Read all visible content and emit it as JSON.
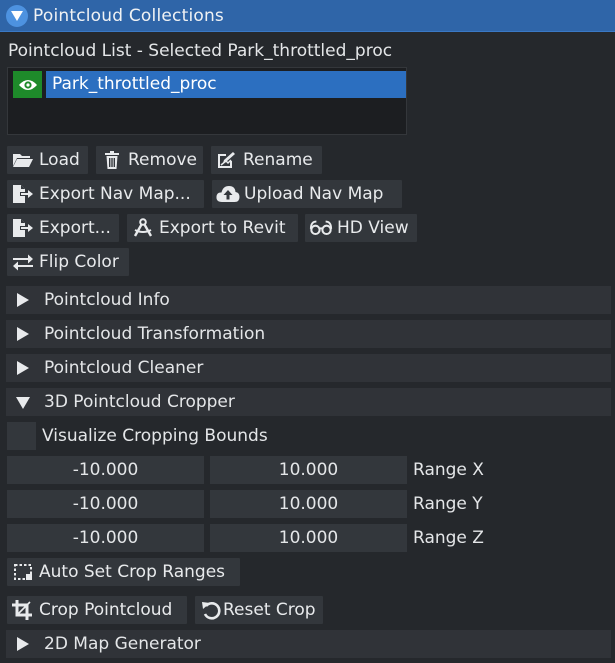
{
  "window": {
    "title": "Pointcloud Collections"
  },
  "list": {
    "label": "Pointcloud List - Selected Park_throttled_proc",
    "items": [
      {
        "name": "Park_throttled_proc",
        "visible": true
      }
    ]
  },
  "buttons": {
    "load": "Load",
    "remove": "Remove",
    "rename": "Rename",
    "export_nav_map": "Export Nav Map...",
    "upload_nav_map": "Upload Nav Map",
    "export": "Export...",
    "export_revit": "Export to Revit",
    "hd_view": "HD View",
    "flip_color": "Flip Color",
    "auto_set_crop": "Auto Set Crop Ranges",
    "crop_pointcloud": "Crop Pointcloud",
    "reset_crop": "Reset Crop"
  },
  "sections": {
    "info": "Pointcloud Info",
    "transformation": "Pointcloud Transformation",
    "cleaner": "Pointcloud Cleaner",
    "cropper": "3D Pointcloud Cropper",
    "map_generator": "2D Map Generator"
  },
  "cropper": {
    "visualize_label": "Visualize Cropping Bounds",
    "visualize_checked": false,
    "ranges": [
      {
        "label": "Range X",
        "min": "-10.000",
        "max": "10.000"
      },
      {
        "label": "Range Y",
        "min": "-10.000",
        "max": "10.000"
      },
      {
        "label": "Range Z",
        "min": "-10.000",
        "max": "10.000"
      }
    ]
  },
  "colors": {
    "title_bar": "#2f65a8",
    "selection": "#2c6fc0",
    "visible_toggle": "#1e8a2a",
    "button": "#33373c",
    "background": "#25282c"
  },
  "icons": {
    "collapse": "triangle-down-icon",
    "visible": "eye-icon",
    "load": "folder-open-icon",
    "remove": "trash-icon",
    "rename": "edit-icon",
    "export_nav": "file-export-icon",
    "upload": "cloud-upload-icon",
    "export": "file-export-icon",
    "revit": "drafting-compass-icon",
    "hd_view": "glasses-icon",
    "flip": "swap-arrows-icon",
    "auto_crop": "dashed-square-icon",
    "crop": "crop-icon",
    "reset": "undo-icon"
  }
}
